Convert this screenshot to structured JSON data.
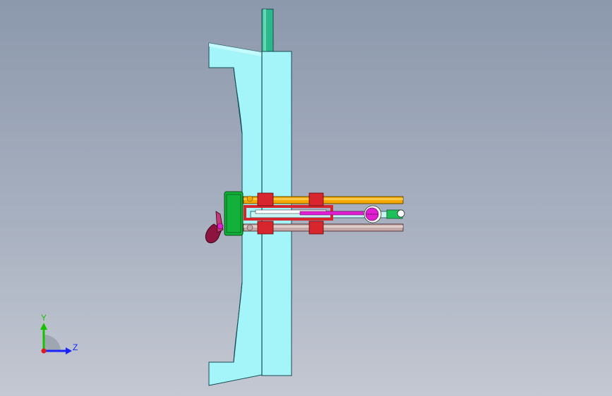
{
  "triad": {
    "y_label": "Y",
    "z_label": "Z",
    "colors": {
      "y": "#16c200",
      "z": "#1a22ff",
      "origin": "#e0191c"
    }
  },
  "colors": {
    "background_top": "#8c98ac",
    "background_bottom": "#c4c8d2",
    "plate": "#a3f5fa",
    "plate_edge": "#1a4c55",
    "guide_pin": "#2bb88a",
    "rod_gold": "#f2a800",
    "rod_grey": "#c3aaa8",
    "block_green": "#12b23a",
    "clamp_red": "#d8262e",
    "slider_magenta": "#e01fd2",
    "handle_maroon": "#8e1440"
  }
}
